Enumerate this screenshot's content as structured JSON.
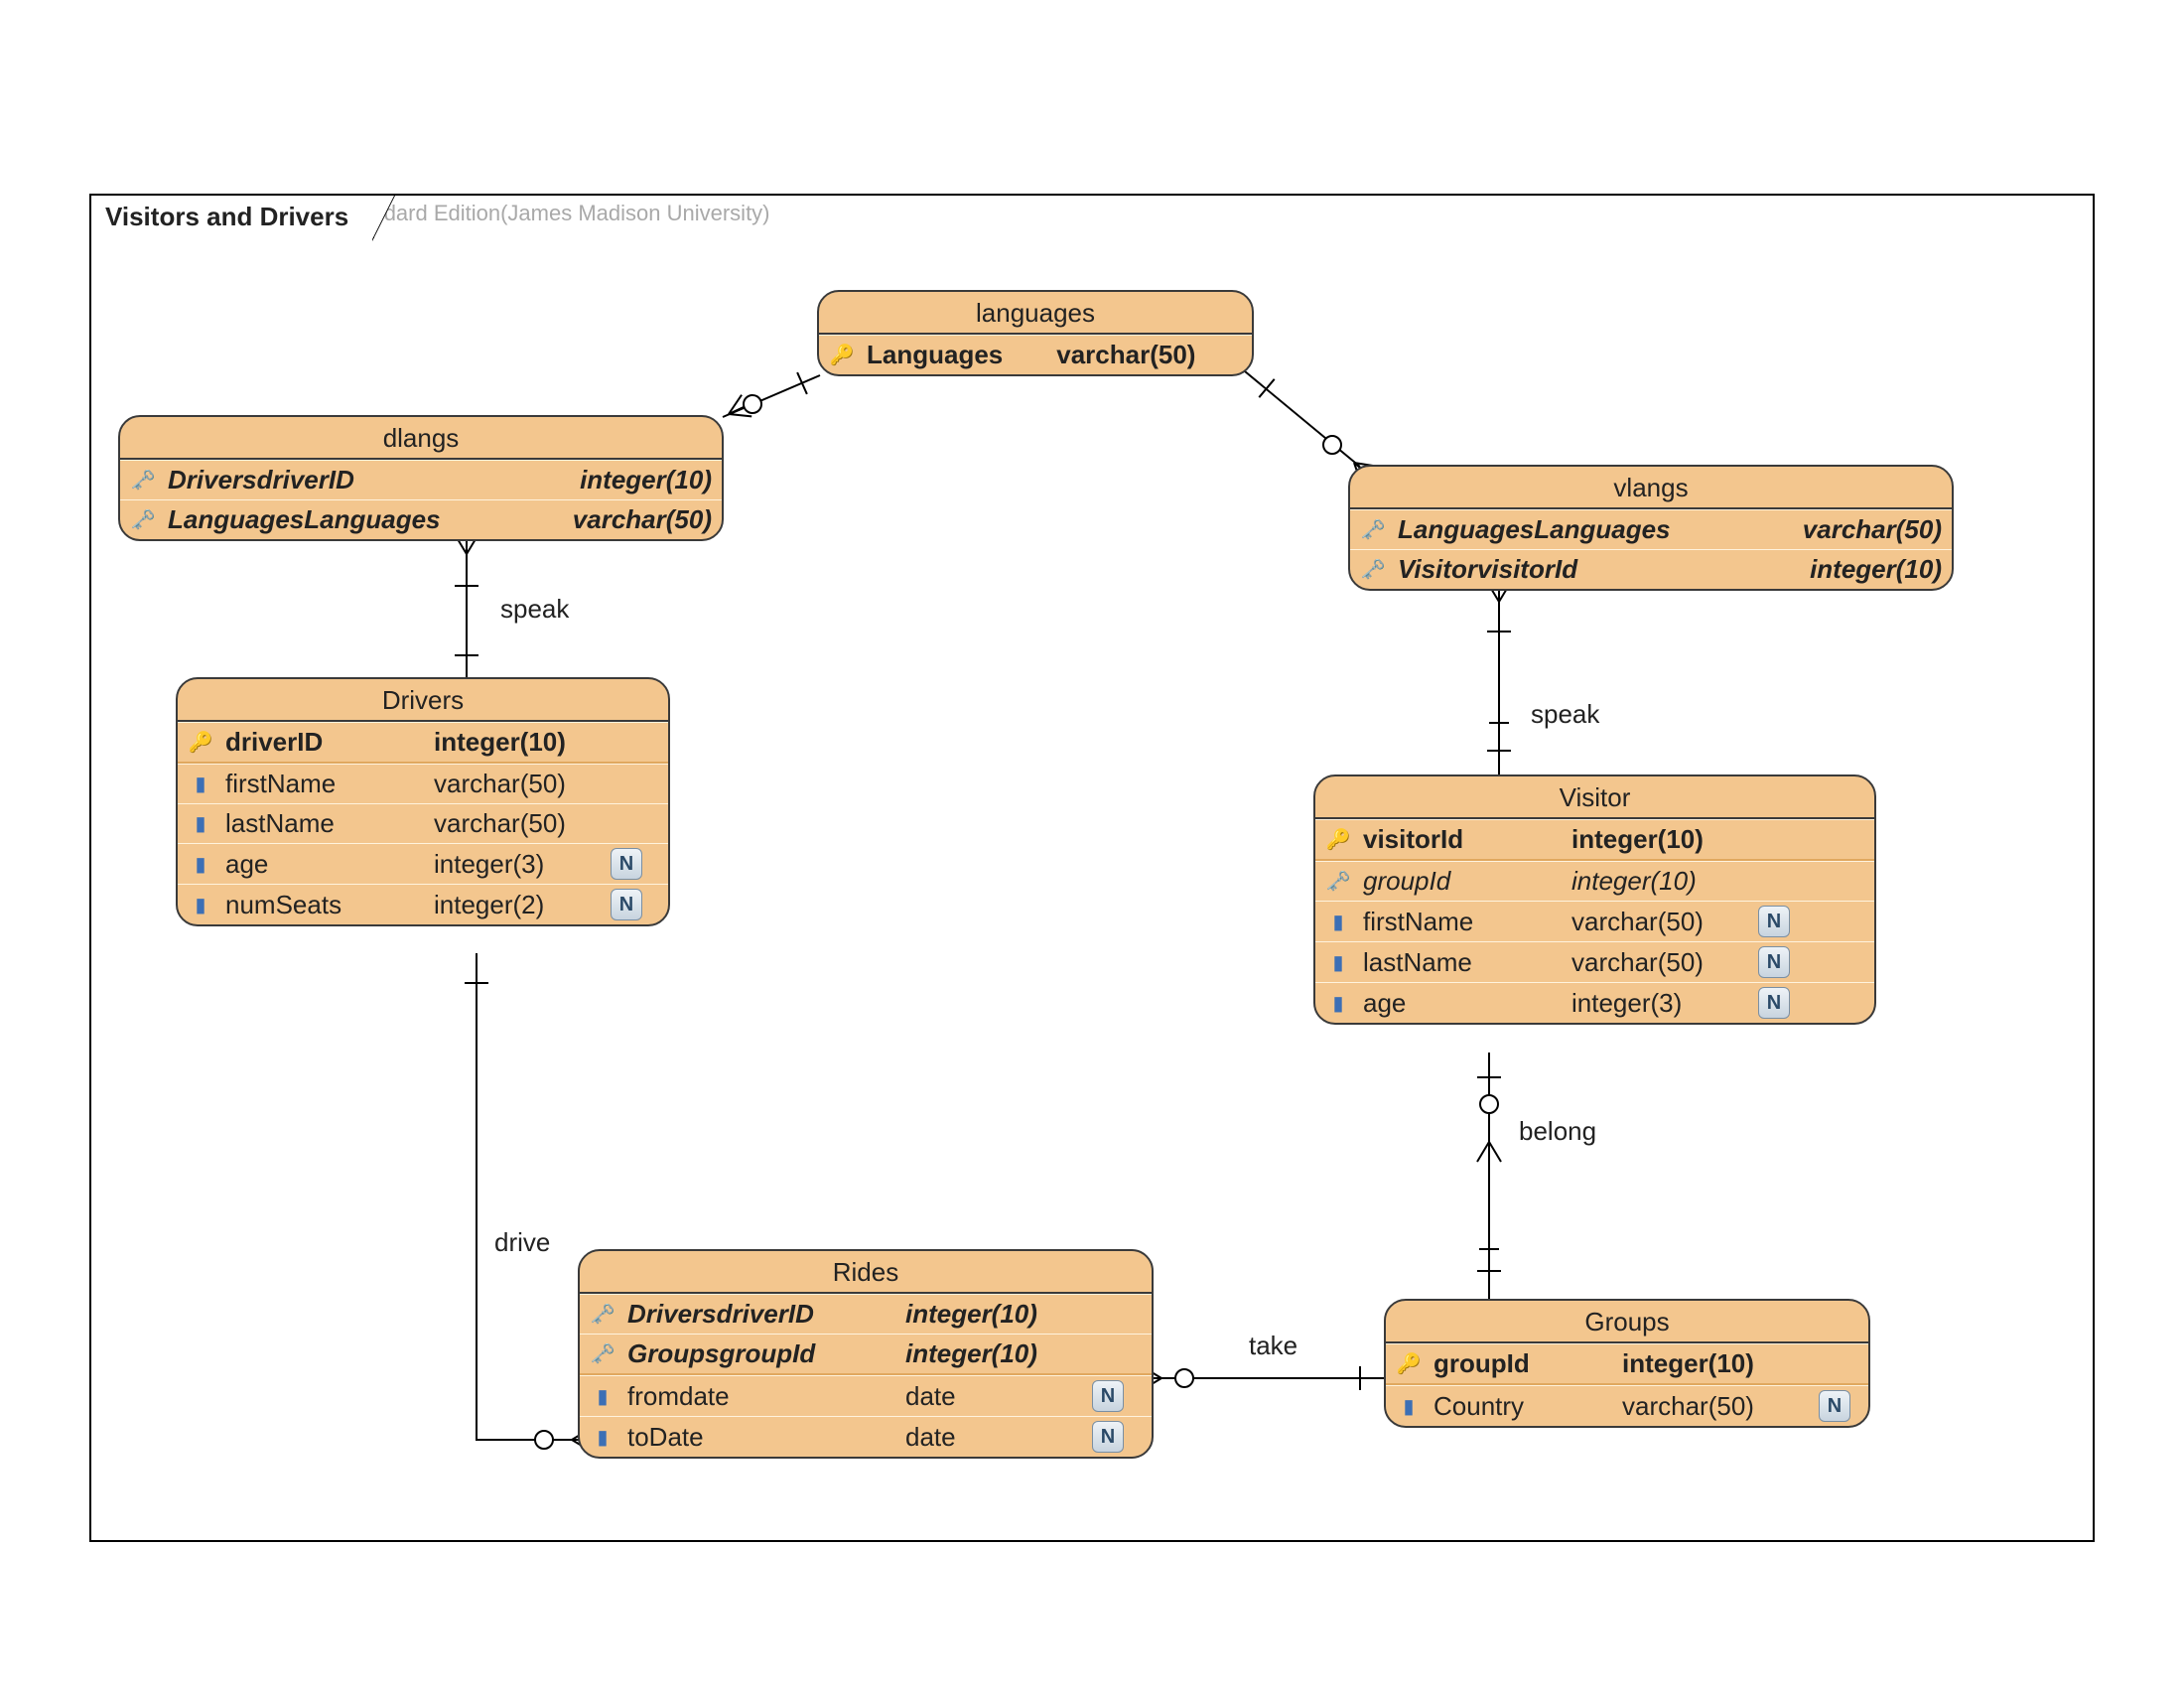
{
  "watermark": "Visual Paradigm for UML Standard Edition(James Madison University)",
  "frame": {
    "title": "Visitors and Drivers"
  },
  "entities": {
    "languages": {
      "title": "languages",
      "rows": [
        {
          "icon": "pk",
          "name": "Languages",
          "type": "varchar(50)",
          "bold": true
        }
      ]
    },
    "dlangs": {
      "title": "dlangs",
      "rows": [
        {
          "icon": "fk",
          "name": "DriversdriverID",
          "type": "integer(10)",
          "bold": true,
          "ital": true
        },
        {
          "icon": "fk",
          "name": "LanguagesLanguages",
          "type": "varchar(50)",
          "bold": true,
          "ital": true
        }
      ]
    },
    "vlangs": {
      "title": "vlangs",
      "rows": [
        {
          "icon": "fk",
          "name": "LanguagesLanguages",
          "type": "varchar(50)",
          "bold": true,
          "ital": true
        },
        {
          "icon": "fk",
          "name": "VisitorvisitorId",
          "type": "integer(10)",
          "bold": true,
          "ital": true
        }
      ]
    },
    "drivers": {
      "title": "Drivers",
      "rows": [
        {
          "icon": "pk",
          "name": "driverID",
          "type": "integer(10)",
          "bold": true
        },
        {
          "icon": "col",
          "name": "firstName",
          "type": "varchar(50)"
        },
        {
          "icon": "col",
          "name": "lastName",
          "type": "varchar(50)"
        },
        {
          "icon": "col",
          "name": "age",
          "type": "integer(3)",
          "nullable": true
        },
        {
          "icon": "col",
          "name": "numSeats",
          "type": "integer(2)",
          "nullable": true
        }
      ]
    },
    "visitor": {
      "title": "Visitor",
      "rows": [
        {
          "icon": "pk",
          "name": "visitorId",
          "type": "integer(10)",
          "bold": true
        },
        {
          "icon": "fk",
          "name": "groupId",
          "type": "integer(10)",
          "ital": true
        },
        {
          "icon": "col",
          "name": "firstName",
          "type": "varchar(50)",
          "nullable": true
        },
        {
          "icon": "col",
          "name": "lastName",
          "type": "varchar(50)",
          "nullable": true
        },
        {
          "icon": "col",
          "name": "age",
          "type": "integer(3)",
          "nullable": true
        }
      ]
    },
    "rides": {
      "title": "Rides",
      "rows": [
        {
          "icon": "fk",
          "name": "DriversdriverID",
          "type": "integer(10)",
          "bold": true,
          "ital": true
        },
        {
          "icon": "fk",
          "name": "GroupsgroupId",
          "type": "integer(10)",
          "bold": true,
          "ital": true
        },
        {
          "icon": "col",
          "name": "fromdate",
          "type": "date",
          "nullable": true
        },
        {
          "icon": "col",
          "name": "toDate",
          "type": "date",
          "nullable": true
        }
      ]
    },
    "groups": {
      "title": "Groups",
      "rows": [
        {
          "icon": "pk",
          "name": "groupId",
          "type": "integer(10)",
          "bold": true
        },
        {
          "icon": "col",
          "name": "Country",
          "type": "varchar(50)",
          "nullable": true
        }
      ]
    }
  },
  "relations": {
    "speak1": "speak",
    "speak2": "speak",
    "drive": "drive",
    "take": "take",
    "belong": "belong"
  },
  "icons": {
    "pk": "🔑",
    "fk": "🗝️",
    "col": "▮",
    "nullable": "N"
  }
}
